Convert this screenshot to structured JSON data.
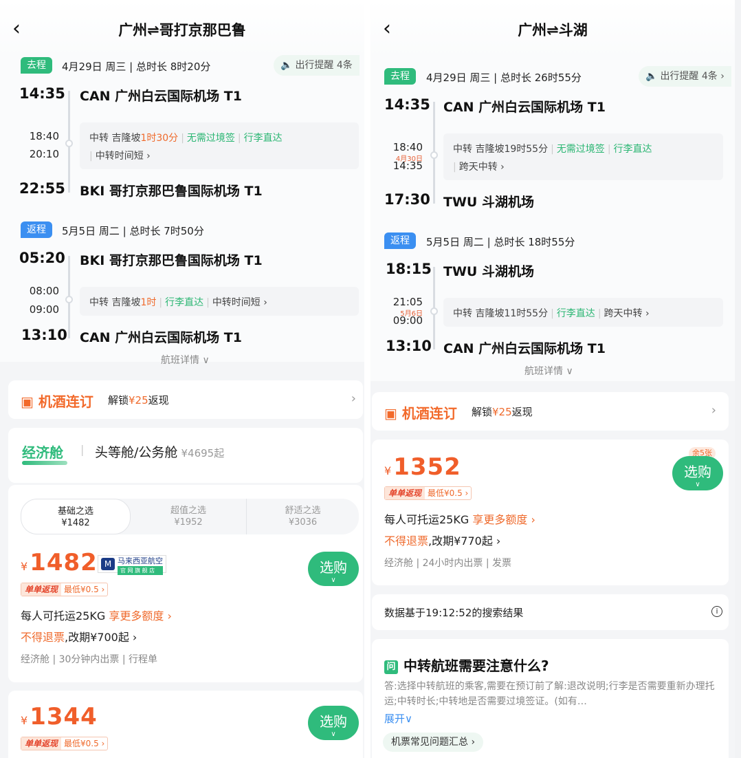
{
  "left": {
    "title": "广州⇌哥打京那巴鲁",
    "outbound": {
      "chip": "去程",
      "info": "4月29日 周三 | 总时长 8时20分",
      "reminder": "出行提醒 4条",
      "dep_time": "14:35",
      "dep_airport": "CAN 广州白云国际机场 T1",
      "transfer_arr": "18:40",
      "transfer_dep": "20:10",
      "transfer_city": "中转 吉隆坡",
      "transfer_duration": "1时30分",
      "tag1": "无需过境签",
      "tag2": "行李直达",
      "tag3": "中转时间短 ›",
      "arr_time": "22:55",
      "arr_airport": "BKI 哥打京那巴鲁国际机场 T1"
    },
    "return": {
      "chip": "返程",
      "info": "5月5日 周二 | 总时长 7时50分",
      "dep_time": "05:20",
      "dep_airport": "BKI 哥打京那巴鲁国际机场 T1",
      "transfer_arr": "08:00",
      "transfer_dep": "09:00",
      "transfer_city": "中转 吉隆坡",
      "transfer_duration": "1时",
      "tag1": "行李直达",
      "tag2": "中转时间短 ›",
      "arr_time": "13:10",
      "arr_airport": "CAN 广州白云国际机场 T1"
    },
    "flight_details": "航班详情 ∨",
    "hotel": {
      "logo": "机酒连订",
      "text_prefix": "解锁",
      "amount": "¥25",
      "text_suffix": "返现"
    },
    "cabins": {
      "economy": "经济舱",
      "first": "头等舱/公务舱",
      "first_price": "¥4695起"
    },
    "segments": [
      {
        "name": "基础之选",
        "price": "¥1482"
      },
      {
        "name": "超值之选",
        "price": "¥1952"
      },
      {
        "name": "舒适之选",
        "price": "¥3036"
      }
    ],
    "offer1": {
      "price": "1482",
      "airline": "马来西亚航空",
      "airline_sub": "官 网 旗 舰 店",
      "buy": "选购",
      "cashback_tag": "单单返现",
      "cashback_min": "最低¥0.5 ›",
      "baggage": "每人可托运25KG",
      "baggage_more": "享更多额度 ›",
      "refund_red": "不得退票",
      "refund_rest": ",改期¥700起 ›",
      "meta": "经济舱 | 30分钟内出票 | 行程单"
    },
    "offer2": {
      "price": "1344",
      "buy": "选购",
      "cashback_tag": "单单返现",
      "cashback_min": "最低¥0.5 ›"
    }
  },
  "right": {
    "title": "广州⇌斗湖",
    "outbound": {
      "chip": "去程",
      "info": "4月29日 周三 | 总时长 26时55分",
      "reminder": "出行提醒 4条 ›",
      "dep_time": "14:35",
      "dep_airport": "CAN 广州白云国际机场 T1",
      "transfer_arr": "18:40",
      "transfer_date": "4月30日",
      "transfer_dep": "14:35",
      "transfer_city": "中转 吉隆坡",
      "transfer_duration": "19时55分",
      "tag1": "无需过境签",
      "tag2": "行李直达",
      "tag3": "跨天中转 ›",
      "arr_time": "17:30",
      "arr_airport": "TWU 斗湖机场"
    },
    "return": {
      "chip": "返程",
      "info": "5月5日 周二 | 总时长 18时55分",
      "dep_time": "18:15",
      "dep_airport": "TWU 斗湖机场",
      "transfer_arr": "21:05",
      "transfer_date": "5月6日",
      "transfer_dep": "09:00",
      "transfer_city": "中转 吉隆坡",
      "transfer_duration": "11时55分",
      "tag1": "行李直达",
      "tag2": "跨天中转 ›",
      "arr_time": "13:10",
      "arr_airport": "CAN 广州白云国际机场 T1"
    },
    "flight_details": "航班详情 ∨",
    "hotel": {
      "logo": "机酒连订",
      "text_prefix": "解锁",
      "amount": "¥25",
      "text_suffix": "返现"
    },
    "offer": {
      "price": "1352",
      "badge": "余5张",
      "buy": "选购",
      "cashback_tag": "单单返现",
      "cashback_min": "最低¥0.5 ›",
      "baggage": "每人可托运25KG",
      "baggage_more": "享更多额度 ›",
      "refund_red": "不得退票",
      "refund_rest": ",改期¥770起 ›",
      "meta": "经济舱 | 24小时内出票 | 发票"
    },
    "search_note": "数据基于19:12:52的搜索结果",
    "qa": {
      "icon": "问",
      "title": "中转航班需要注意什么?",
      "text": "答:选择中转航班的乘客,需要在预订前了解:退改说明;行李是否需要重新办理托运;中转时长;中转地是否需要过境签证。(如有…",
      "expand": "展开∨",
      "faq": "机票常见问题汇总 ›"
    }
  },
  "icons": {
    "back": "chevron-left-icon",
    "speaker": "speaker-icon",
    "hotel": "hotel-icon",
    "info": "info-icon"
  },
  "colors": {
    "green": "#2fbb7c",
    "blue": "#3b8ff1",
    "orange": "#f05e2a"
  }
}
